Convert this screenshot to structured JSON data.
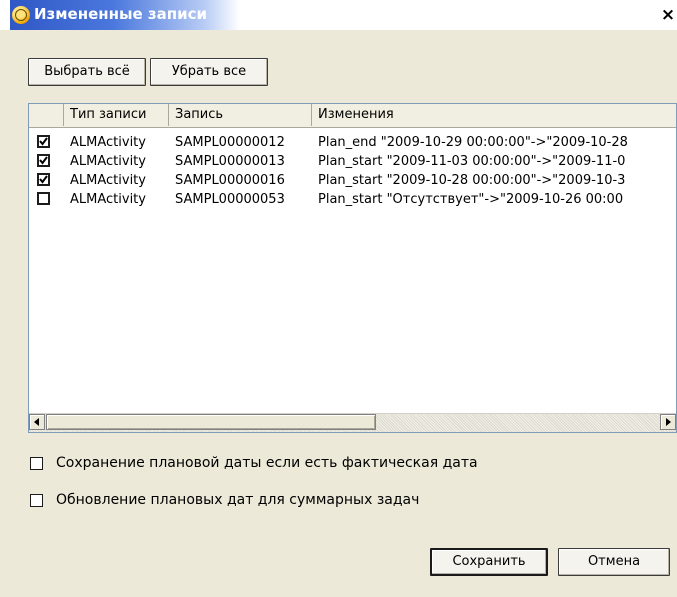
{
  "window": {
    "title": "Измененные записи",
    "close_glyph": "×"
  },
  "toolbar": {
    "select_all": "Выбрать всё",
    "deselect_all": "Убрать все"
  },
  "table": {
    "columns": [
      "Тип записи",
      "Запись",
      "Изменения"
    ],
    "rows": [
      {
        "checked": true,
        "type": "ALMActivity",
        "record": "SAMPL00000012",
        "change": "Plan_end \"2009-10-29 00:00:00\"->\"2009-10-28"
      },
      {
        "checked": true,
        "type": "ALMActivity",
        "record": "SAMPL00000013",
        "change": "Plan_start \"2009-11-03 00:00:00\"->\"2009-11-0"
      },
      {
        "checked": true,
        "type": "ALMActivity",
        "record": "SAMPL00000016",
        "change": "Plan_start \"2009-10-28 00:00:00\"->\"2009-10-3"
      },
      {
        "checked": false,
        "type": "ALMActivity",
        "record": "SAMPL00000053",
        "change": "Plan_start \"Отсутствует\"->\"2009-10-26 00:00"
      }
    ]
  },
  "options": {
    "keep_planned": "Сохранение плановой даты если есть фактическая дата",
    "update_summary": "Обновление плановых дат для суммарных задач"
  },
  "footer": {
    "save": "Сохранить",
    "cancel": "Отмена"
  }
}
